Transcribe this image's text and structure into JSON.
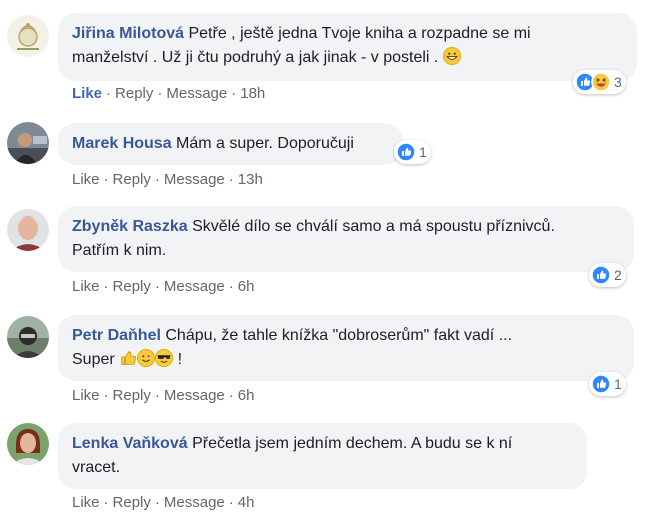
{
  "comments": [
    {
      "author": "Jiřina Milotová",
      "text1": "Petře , ještě jedna Tvoje kniha a rozpadne se mi",
      "text2": "manželství . Už ji čtu podruhý a jak jinak - v posteli .",
      "reaction_count": "3",
      "actions": {
        "like": "Like",
        "reply": "Reply",
        "message": "Message",
        "time": "18h"
      }
    },
    {
      "author": "Marek Housa",
      "text1": "Mám a super. Doporučuji",
      "reaction_count": "1",
      "actions": {
        "like": "Like",
        "reply": "Reply",
        "message": "Message",
        "time": "13h"
      }
    },
    {
      "author": "Zbyněk Raszka",
      "text1": "Skvělé dílo se chválí samo a má spoustu příznivců.",
      "text2": "Patřím k nim.",
      "reaction_count": "2",
      "actions": {
        "like": "Like",
        "reply": "Reply",
        "message": "Message",
        "time": "6h"
      }
    },
    {
      "author": "Petr Daňhel",
      "text1": "Chápu, že tahle knížka \"dobroserům\" fakt vadí ...",
      "text2a": "Super",
      "text2b": "!",
      "reaction_count": "1",
      "actions": {
        "like": "Like",
        "reply": "Reply",
        "message": "Message",
        "time": "6h"
      }
    },
    {
      "author": "Lenka Vaňková",
      "text1": "Přečetla jsem jedním dechem. A budu se k ní",
      "text2": "vracet.",
      "actions": {
        "like": "Like",
        "reply": "Reply",
        "message": "Message",
        "time": "4h"
      }
    }
  ],
  "separator": "·",
  "colors": {
    "bubble": "#f2f3f5",
    "author": "#385898",
    "like_blue": "#4267b2",
    "meta": "#606770"
  },
  "icons": [
    "like-icon",
    "haha-icon",
    "grinning-emoji",
    "thumbs-up-emoji",
    "smile-emoji",
    "sunglasses-emoji"
  ]
}
